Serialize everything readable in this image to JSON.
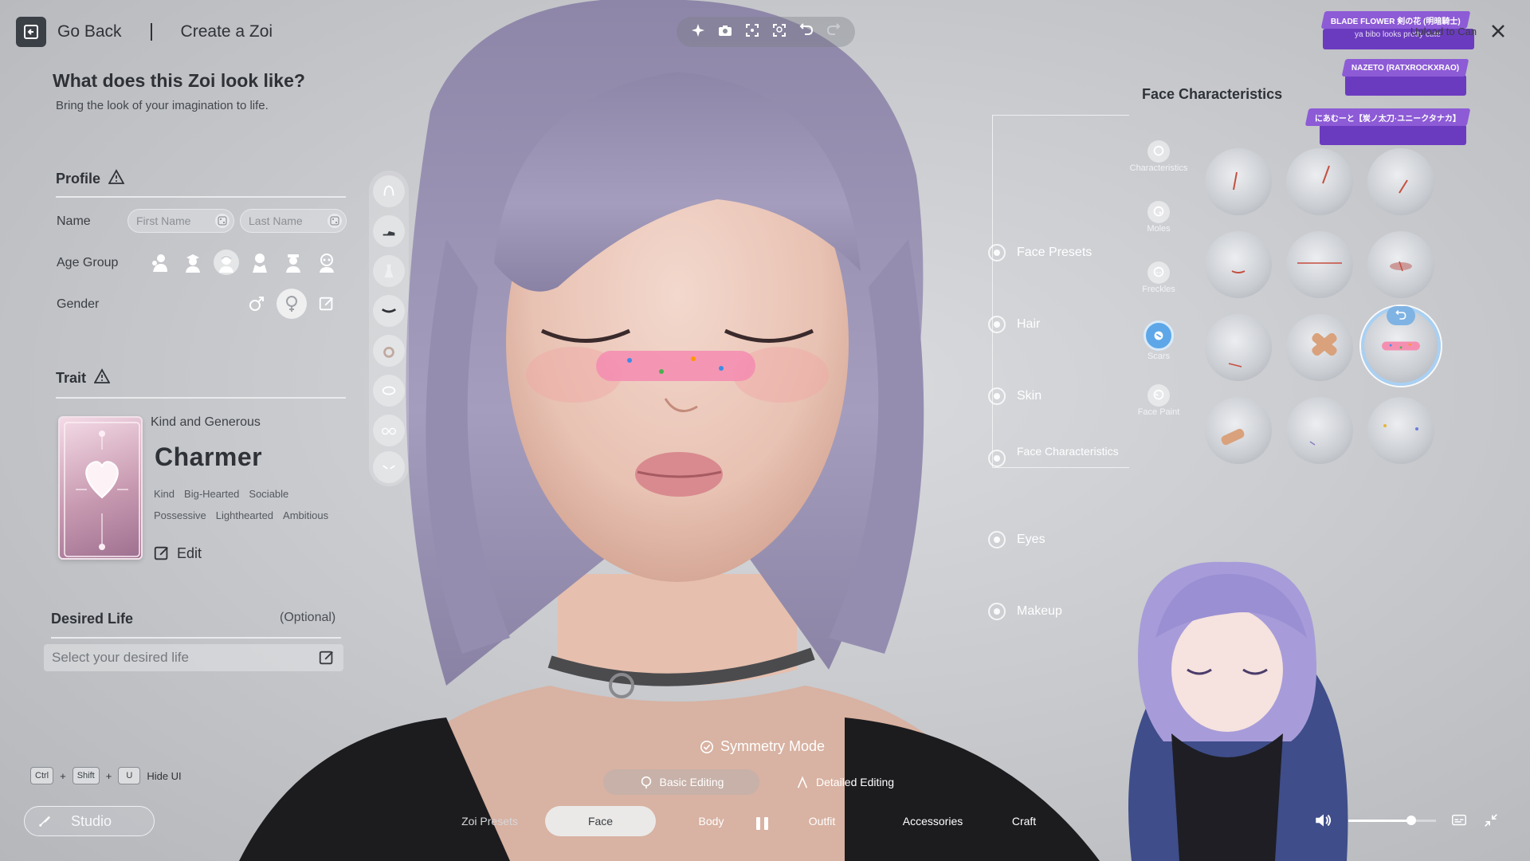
{
  "topbar": {
    "back_label": "Go Back",
    "screen_title": "Create a Zoi"
  },
  "header": {
    "title": "What does this Zoi look like?",
    "subtitle": "Bring the look of your imagination to life."
  },
  "profile": {
    "section_title": "Profile",
    "name_label": "Name",
    "first_name_placeholder": "First Name",
    "last_name_placeholder": "Last Name",
    "age_group_label": "Age Group",
    "age_groups": [
      "infant-icon",
      "child-icon",
      "teen-icon",
      "adult-icon",
      "older-adult-icon",
      "elder-icon"
    ],
    "selected_age_group": "teen-icon",
    "gender_label": "Gender",
    "genders": [
      "male-symbol-icon",
      "female-symbol-icon",
      "edit-icon"
    ],
    "selected_gender": "female-symbol-icon"
  },
  "trait": {
    "section_title": "Trait",
    "category": "Kind and Generous",
    "name": "Charmer",
    "tags_row1": [
      "Kind",
      "Big-Hearted",
      "Sociable"
    ],
    "tags_row2": [
      "Possessive",
      "Lighthearted",
      "Ambitious"
    ],
    "edit_label": "Edit"
  },
  "desired_life": {
    "title": "Desired Life",
    "optional_label": "(Optional)",
    "placeholder": "Select your desired life"
  },
  "shortcut": {
    "keys": [
      "Ctrl",
      "Shift",
      "U"
    ],
    "plus": "+",
    "label": "Hide UI"
  },
  "studio": {
    "label": "Studio"
  },
  "category_strip": [
    "hair-icon",
    "shoes-icon",
    "dress-icon",
    "choker-icon",
    "ring-icon",
    "bracelet-icon",
    "glasses-icon",
    "mask-icon"
  ],
  "toolbar": [
    "sparkle-icon",
    "camera-icon",
    "focus-icon",
    "face-focus-icon",
    "undo-icon",
    "redo-icon"
  ],
  "nav": {
    "items": [
      "Face Presets",
      "Hair",
      "Skin",
      "Face Characteristics",
      "Eyes",
      "Makeup"
    ],
    "selected": "Face Characteristics"
  },
  "face_characteristics": {
    "title": "Face Characteristics",
    "sub_categories": [
      "Characteristics",
      "Moles",
      "Freckles",
      "Scars",
      "Face Paint"
    ],
    "selected_sub_category": "Scars",
    "tiles": [
      "scar-cheek-icon",
      "scar-eye-icon",
      "scar-side-icon",
      "scar-nose-icon",
      "scar-line-icon",
      "scar-lip-icon",
      "scar-jaw-icon",
      "bandage-icon",
      "nose-bandage-icon",
      "patch-icon",
      "scratch-icon",
      "spot-icon"
    ],
    "selected_tile_index": 8
  },
  "alerts": [
    {
      "text": "BLADE FLOWER 剣の花 (明暗騎士)",
      "message": "ya bibo looks pretty cute"
    },
    {
      "text": "NAZETO (RATXROCKXRAO)"
    },
    {
      "text": "にあむーと【炭ノ太刀·ユニークタナカ】"
    }
  ],
  "upload_label": "Upload to Can",
  "bottom": {
    "symmetry_label": "Symmetry Mode",
    "basic_editing": "Basic Editing",
    "detailed_editing": "Detailed Editing",
    "tabs": [
      "Zoi Presets",
      "Face",
      "Body",
      "Outfit",
      "Accessories",
      "Craft"
    ],
    "selected_tab": "Face"
  },
  "media": {
    "volume": 0.72
  },
  "colors": {
    "accent_blue": "#5da7e8",
    "alert_purple": "#8d5bd6",
    "panel_text": "#2f3338"
  }
}
